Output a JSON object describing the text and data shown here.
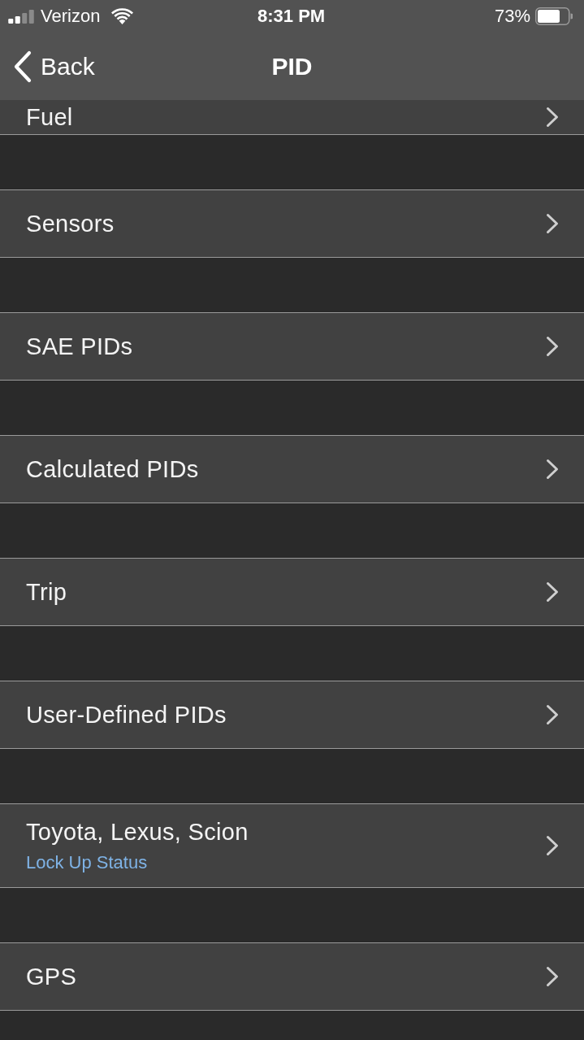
{
  "status_bar": {
    "carrier": "Verizon",
    "time": "8:31 PM",
    "battery": "73%"
  },
  "nav_bar": {
    "back": "Back",
    "title": "PID"
  },
  "sections": [
    {
      "title": "Fuel"
    },
    {
      "title": "Sensors"
    },
    {
      "title": "SAE PIDs"
    },
    {
      "title": "Calculated PIDs"
    },
    {
      "title": "Trip"
    },
    {
      "title": "User-Defined PIDs"
    },
    {
      "title": "Toyota, Lexus, Scion",
      "subtitle": "Lock Up Status"
    },
    {
      "title": "GPS"
    }
  ]
}
